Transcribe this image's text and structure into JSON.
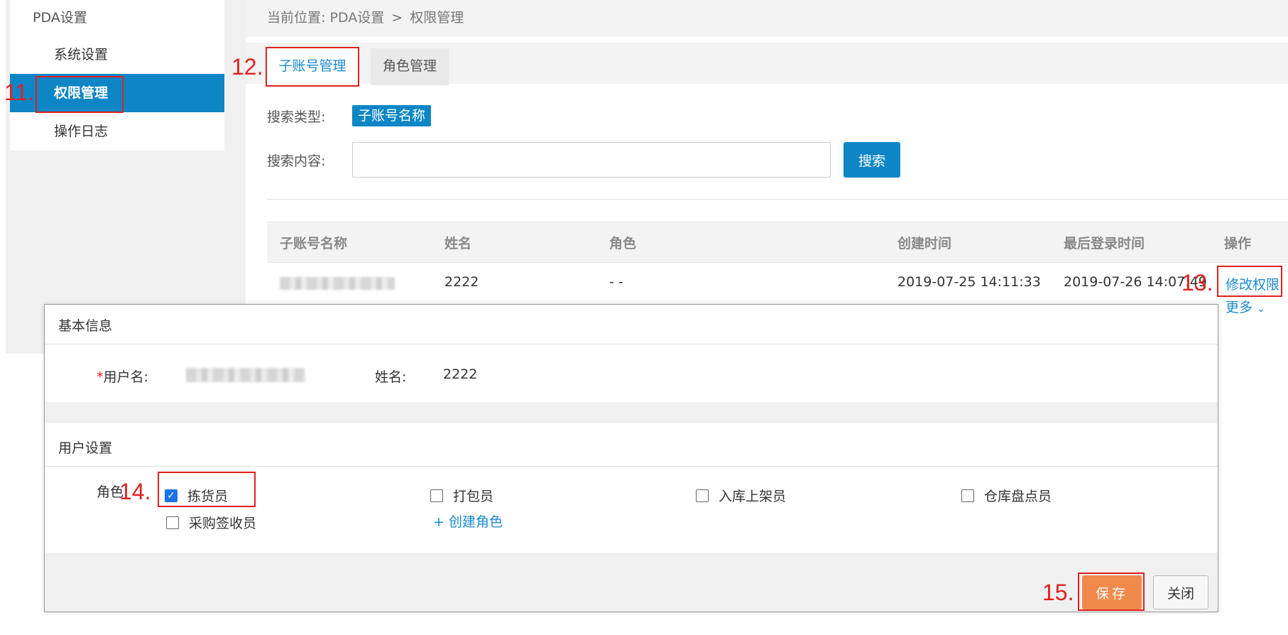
{
  "sidebar": {
    "group_title": "PDA设置",
    "items": [
      {
        "label": "系统设置"
      },
      {
        "label": "权限管理"
      },
      {
        "label": "操作日志"
      }
    ]
  },
  "breadcrumb": {
    "prefix": "当前位置:",
    "path": [
      "PDA设置",
      "权限管理"
    ],
    "separator": ">"
  },
  "tabs": [
    {
      "label": "子账号管理",
      "active": true
    },
    {
      "label": "角色管理",
      "active": false
    }
  ],
  "search": {
    "type_label": "搜索类型:",
    "type_value": "子账号名称",
    "content_label": "搜索内容:",
    "content_value": "",
    "button_label": "搜索"
  },
  "table": {
    "columns": [
      "子账号名称",
      "姓名",
      "角色",
      "创建时间",
      "最后登录时间",
      "操作"
    ],
    "rows": [
      {
        "name": "2222",
        "role": "- -",
        "created": "2019-07-25 14:11:33",
        "last_login": "2019-07-26 14:07:49",
        "action_edit": "修改权限",
        "action_more": "更多"
      }
    ]
  },
  "modal": {
    "basic_title": "基本信息",
    "username_label": "用户名:",
    "required_mark": "*",
    "name_label": "姓名:",
    "name_value": "2222",
    "user_settings_title": "用户设置",
    "roles_label": "角色:",
    "roles": [
      {
        "label": "拣货员",
        "checked": true
      },
      {
        "label": "打包员",
        "checked": false
      },
      {
        "label": "入库上架员",
        "checked": false
      },
      {
        "label": "仓库盘点员",
        "checked": false
      },
      {
        "label": "采购签收员",
        "checked": false
      }
    ],
    "create_role_link": "+ 创建角色",
    "save_label": "保存",
    "close_label": "关闭"
  },
  "annotations": [
    "11.",
    "12.",
    "13.",
    "14.",
    "15."
  ],
  "colors": {
    "accent_blue": "#0e86c6",
    "link_blue": "#1a8bd0",
    "save_orange": "#f08a4b",
    "annotation_red": "#e02020"
  }
}
